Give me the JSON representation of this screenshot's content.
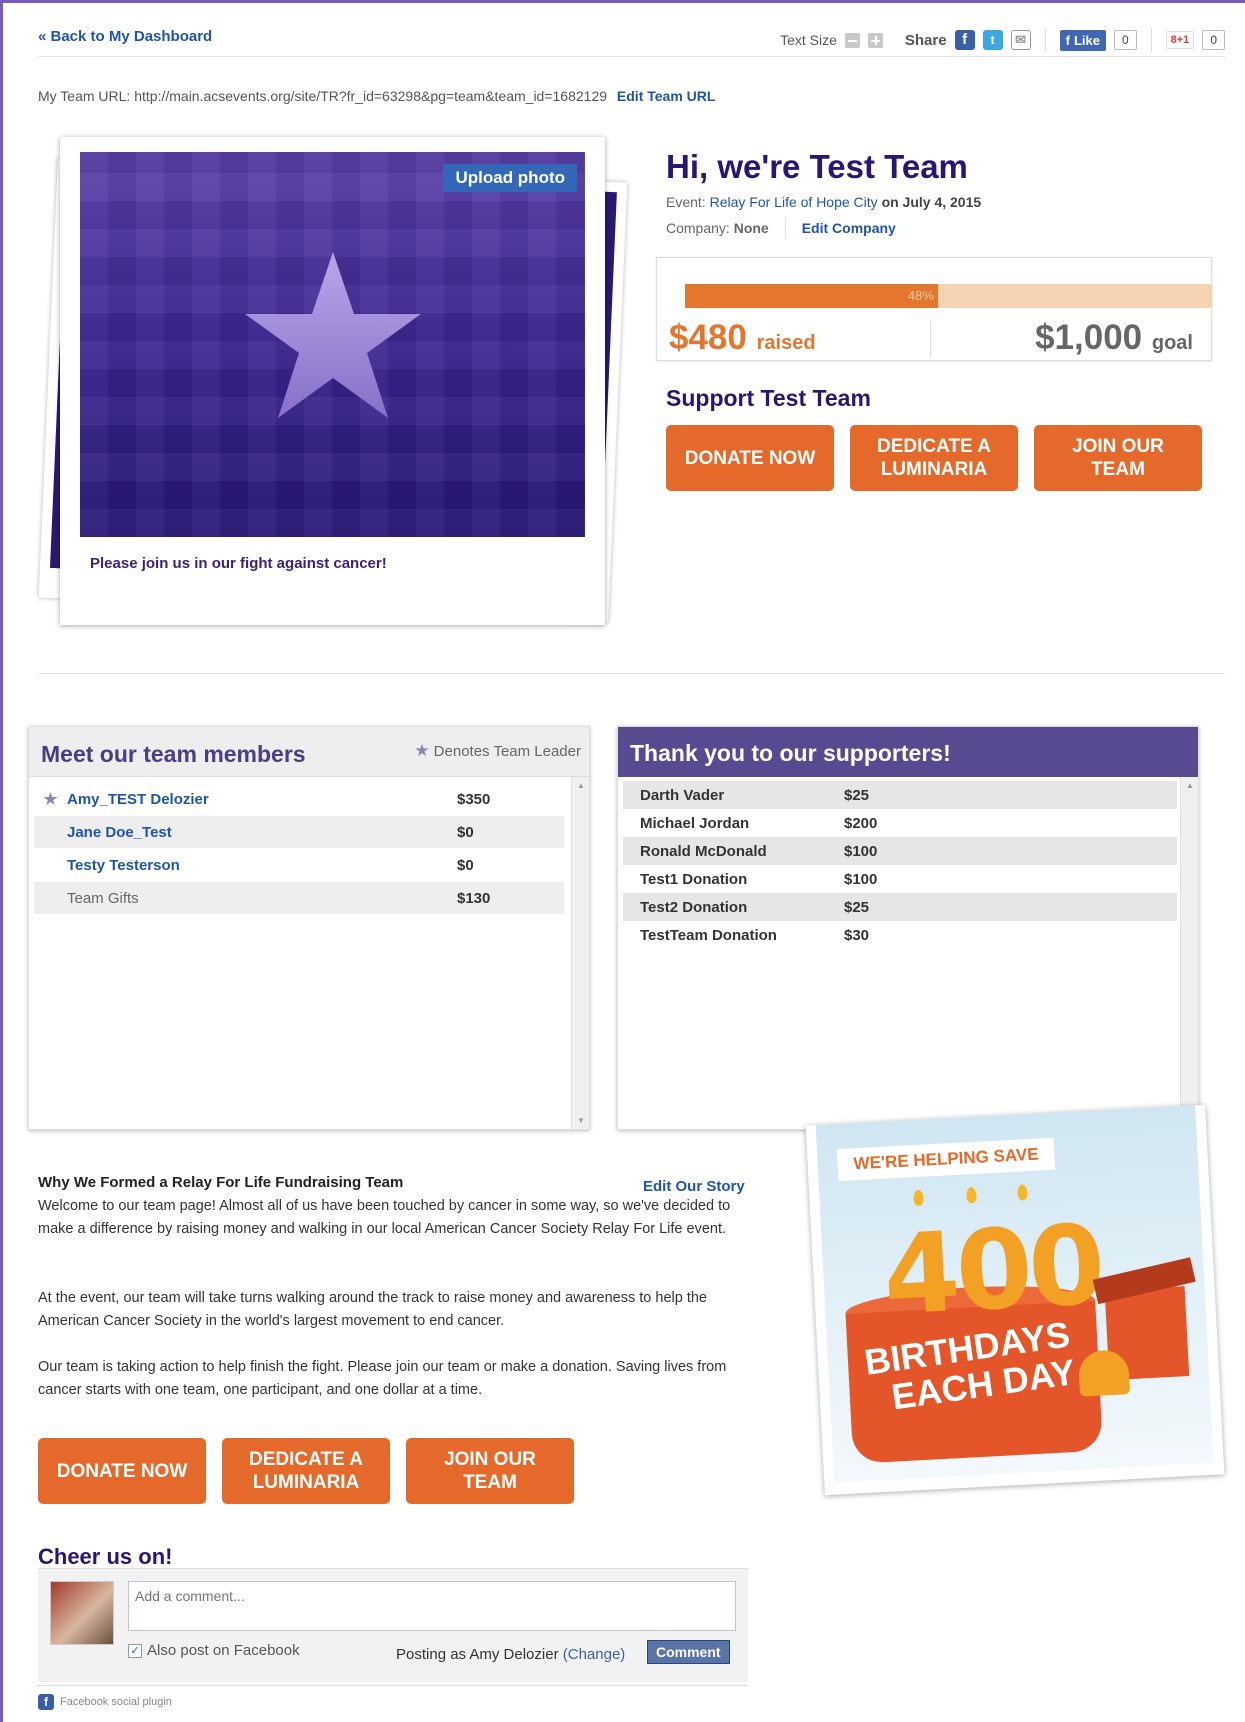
{
  "topbar": {
    "back_label": "« Back to My Dashboard",
    "text_size_label": "Text Size",
    "share_label": "Share",
    "like_label": "Like",
    "like_count": "0",
    "gplus_label": "8+1",
    "gplus_count": "0"
  },
  "team_url": {
    "label": "My Team URL:",
    "value": "http://main.acsevents.org/site/TR?fr_id=63298&pg=team&team_id=1682129",
    "edit_label": "Edit Team URL"
  },
  "photo": {
    "upload_label": "Upload photo",
    "caption": "Please join us in our fight against cancer!"
  },
  "header": {
    "title": "Hi, we're Test Team",
    "event_label": "Event:",
    "event_name": "Relay For Life of Hope City",
    "event_on": "on July 4, 2015",
    "company_label": "Company:",
    "company_value": "None",
    "edit_company_label": "Edit Company"
  },
  "progress": {
    "percent": 48,
    "percent_label": "48%",
    "raised_amount": "$480",
    "raised_label": "raised",
    "goal_amount": "$1,000",
    "goal_label": "goal",
    "accent_color": "#e4762d",
    "track_color": "#f5d3b2"
  },
  "support": {
    "title": "Support Test Team",
    "buttons": [
      {
        "label": "DONATE NOW"
      },
      {
        "label": "DEDICATE A LUMINARIA"
      },
      {
        "label": "JOIN OUR TEAM"
      }
    ]
  },
  "members": {
    "title": "Meet our team members",
    "legend": "Denotes Team Leader",
    "rows": [
      {
        "name": "Amy_TEST Delozier",
        "amount": "$350",
        "leader": true
      },
      {
        "name": "Jane Doe_Test",
        "amount": "$0",
        "leader": false
      },
      {
        "name": "Testy Testerson",
        "amount": "$0",
        "leader": false
      },
      {
        "name": "Team Gifts",
        "amount": "$130",
        "leader": false
      }
    ]
  },
  "supporters": {
    "title": "Thank you to our supporters!",
    "rows": [
      {
        "name": "Darth Vader",
        "amount": "$25"
      },
      {
        "name": "Michael Jordan",
        "amount": "$200"
      },
      {
        "name": "Ronald McDonald",
        "amount": "$100"
      },
      {
        "name": "Test1 Donation",
        "amount": "$100"
      },
      {
        "name": "Test2 Donation",
        "amount": "$25"
      },
      {
        "name": "TestTeam Donation",
        "amount": "$30"
      }
    ]
  },
  "story": {
    "title": "Why We Formed a Relay For Life Fundraising Team",
    "edit_label": "Edit Our Story",
    "p1": "Welcome to our team page! Almost all of us have been touched by cancer in some way, so we've decided to make a difference by raising money and walking in our local American Cancer Society Relay For Life event.",
    "p2": "At the event, our team will take turns walking around the track to raise money and awareness to help the American Cancer Society in the world's largest movement to end cancer.",
    "p3": "Our team is taking action to help finish the fight. Please join our team or make a donation. Saving lives from cancer starts with one team, one participant, and one dollar at a time."
  },
  "promo": {
    "ribbon": "WE'RE HELPING SAVE",
    "number": "400",
    "line1": "BIRTHDAYS",
    "line2": "EACH DAY"
  },
  "cheer": {
    "title": "Cheer us on!",
    "comment_placeholder": "Add a comment...",
    "also_post_label": "Also post on Facebook",
    "posting_as_label": "Posting as Amy Delozier",
    "change_label": "(Change)",
    "comment_button": "Comment",
    "plugin_label": "Facebook social plugin"
  }
}
